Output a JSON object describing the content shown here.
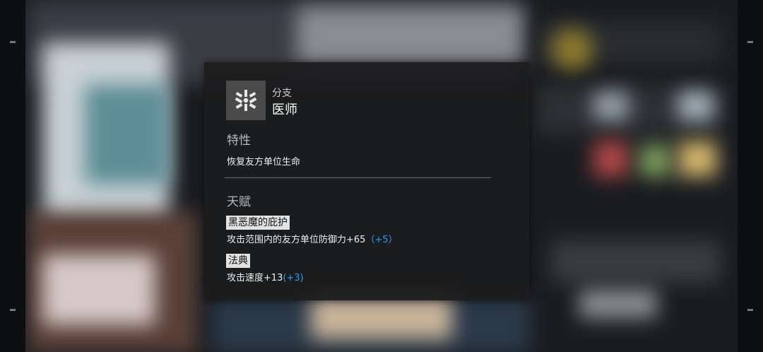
{
  "branch": {
    "icon": "medic-branch-icon",
    "caption": "分支",
    "name": "医师"
  },
  "trait": {
    "title": "特性",
    "description": "恢复友方单位生命"
  },
  "talents": {
    "title": "天赋",
    "items": [
      {
        "name": "黑恶魔的庇护",
        "description": "攻击范围内的友方单位防御力+65",
        "bonus": "（+5）"
      },
      {
        "name": "法典",
        "description": "攻击速度+13",
        "bonus": "(+3)"
      }
    ]
  },
  "colors": {
    "panel_bg": "#1c1c1d",
    "bonus_text": "#2f9bff",
    "tag_bg": "#e2e2e2"
  }
}
